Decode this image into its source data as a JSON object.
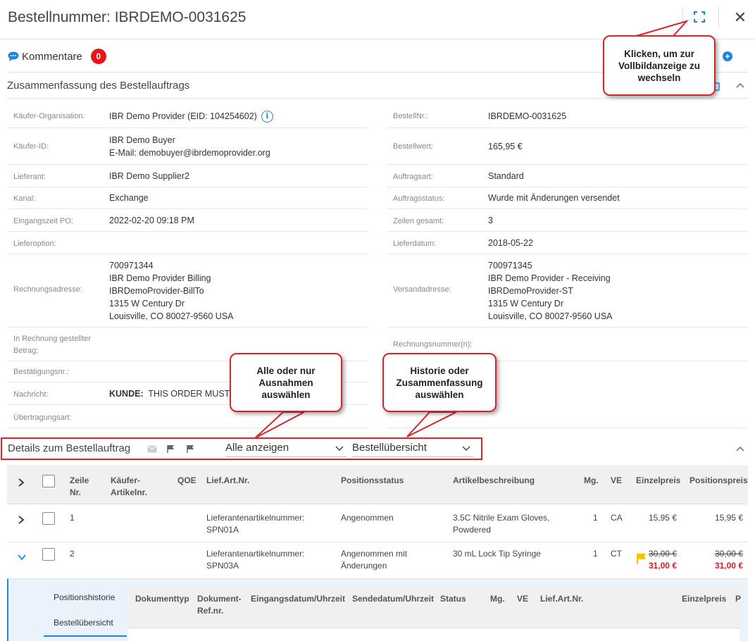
{
  "header": {
    "title": "Bestellnummer: IBRDEMO-0031625",
    "fullscreen_icon": "fullscreen-icon",
    "close_glyph": "✕"
  },
  "comments": {
    "label": "Kommentare",
    "count": "0"
  },
  "summary": {
    "title": "Zusammenfassung des Bestellauftrags",
    "left": [
      {
        "key": "Käufer-Organisation:",
        "value": [
          "IBR Demo Provider (EID: 104254602)"
        ]
      },
      {
        "key": "Käufer-ID:",
        "value": [
          "IBR Demo Buyer",
          "E-Mail: demobuyer@ibrdemoprovider.org"
        ]
      },
      {
        "key": "Lieferant:",
        "value": [
          "IBR Demo Supplier2"
        ]
      },
      {
        "key": "Kanal:",
        "value": [
          "Exchange"
        ]
      },
      {
        "key": "Eingangszeit PO:",
        "value": [
          "2022-02-20 09:18 PM"
        ]
      },
      {
        "key": "Lieferoption:",
        "value": []
      },
      {
        "key": "Rechnungsadresse:",
        "value": [
          "700971344",
          "IBR Demo Provider Billing",
          "IBRDemoProvider-BillTo",
          "1315 W Century Dr",
          "Louisville, CO 80027-9560 USA"
        ]
      },
      {
        "key": "In Rechnung gestellter Betrag:",
        "value": []
      },
      {
        "key": "Bestätigungsnr.:",
        "value": []
      },
      {
        "key": "Nachricht:",
        "value_label": "KUNDE:",
        "value": [
          "THIS ORDER MUST BE"
        ]
      },
      {
        "key": "Übertragungsart:",
        "value": []
      }
    ],
    "right": [
      {
        "key": "BestellNr.:",
        "value": [
          "IBRDEMO-0031625"
        ]
      },
      {
        "key": "Bestellwert:",
        "value": [
          "165,95 €"
        ]
      },
      {
        "key": "Auftragsart:",
        "value": [
          "Standard"
        ]
      },
      {
        "key": "Auftragsstatus:",
        "value": [
          "Wurde mit Änderungen versendet"
        ]
      },
      {
        "key": "Zeilen gesamt:",
        "value": [
          "3"
        ]
      },
      {
        "key": "Lieferdatum:",
        "value": [
          "2018-05-22"
        ]
      },
      {
        "key": "Versandadresse:",
        "value": [
          "700971345",
          "IBR Demo Provider - Receiving",
          "IBRDemoProvider-ST",
          "1315 W Century Dr",
          "Louisville, CO 80027-9560 USA"
        ]
      },
      {
        "key": "Rechnungsnummer(n):",
        "value": []
      }
    ]
  },
  "callouts": {
    "fullscreen": "Klicken, um zur Vollbildanzeige zu wechseln",
    "filter": "Alle oder nur Ausnahmen auswählen",
    "view": "Historie oder Zusammenfassung auswählen"
  },
  "details": {
    "title": "Details zum Bestellauftrag",
    "filter_value": "Alle anzeigen",
    "view_value": "Bestellübersicht"
  },
  "table": {
    "headers": {
      "line_no": "Zeile Nr.",
      "buyer_part": "Käufer-Artikelnr.",
      "qoe": "QOE",
      "supplier_part": "Lief.Art.Nr.",
      "status": "Positionsstatus",
      "desc": "Artikelbeschreibung",
      "qty": "Mg.",
      "uom": "VE",
      "unit_price": "Einzelpreis",
      "line_price": "Positionspreis"
    },
    "rows": [
      {
        "line": "1",
        "supplier_part": "Lieferantenartikelnummer: SPN01A",
        "status": "Angenommen",
        "desc": "3.5C Nitrile Exam Gloves, Powdered",
        "qty": "1",
        "uom": "CA",
        "unit_price": "15,95 €",
        "line_price": "15,95 €"
      },
      {
        "line": "2",
        "supplier_part": "Lieferantenartikelnummer: SPN03A",
        "status": "Angenommen mit Änderungen",
        "desc": "30 mL Lock Tip Syringe",
        "qty": "1",
        "uom": "CT",
        "unit_price_old": "30,00 €",
        "unit_price": "31,00 €",
        "line_price_old": "30,00 €",
        "line_price": "31,00 €"
      }
    ]
  },
  "subpanel": {
    "nav": [
      "Positionshistorie",
      "Bestellübersicht"
    ],
    "headers": {
      "doc_type": "Dokumenttyp",
      "doc_ref": "Dokument-Ref.nr.",
      "received": "Eingangsdatum/Uhrzeit",
      "sent": "Sendedatum/Uhrzeit",
      "status": "Status",
      "qty": "Mg.",
      "uom": "VE",
      "supplier_part": "Lief.Art.Nr.",
      "unit_price": "Einzelpreis",
      "more": "P"
    }
  },
  "colors": {
    "accent": "#1f86e0",
    "callout_border": "#d7262b",
    "badge": "#e8141a",
    "flag": "#f5c400"
  }
}
